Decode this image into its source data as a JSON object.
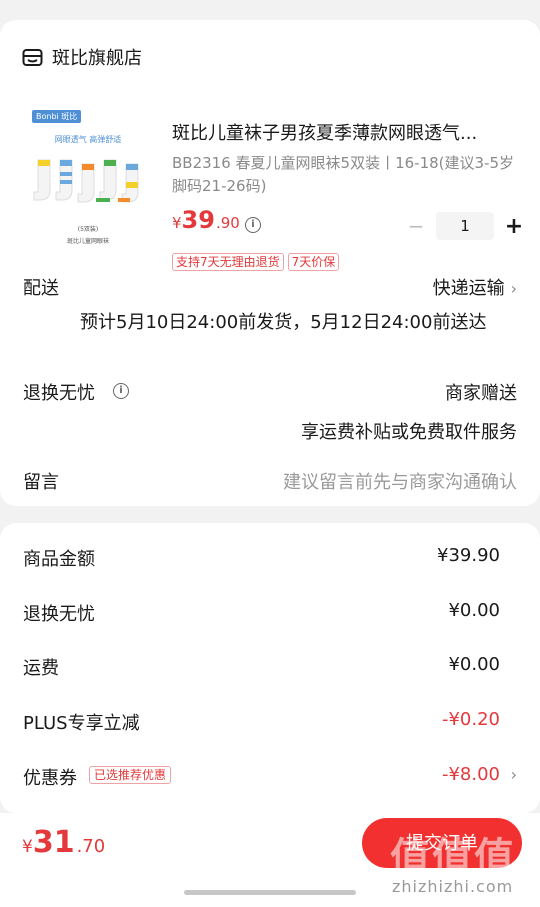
{
  "shop": {
    "name": "斑比旗舰店",
    "icon": "shop-icon"
  },
  "product": {
    "thumb": {
      "brand_tag": "Bonbi 斑比",
      "slogan": "网眼透气 高弹舒适",
      "count_label": "(5双装)",
      "caption": "斑比儿童网眼袜"
    },
    "title": "斑比儿童袜子男孩夏季薄款网眼透气...",
    "spec": "BB2316 春夏儿童网眼袜5双装丨16-18(建议3-5岁脚码21-26码)",
    "price": {
      "currency": "¥",
      "integer": "39",
      "decimal": ".90"
    },
    "quantity": "1",
    "tags": [
      "支持7天无理由退货",
      "7天价保"
    ]
  },
  "delivery": {
    "label": "配送",
    "method": "快递运输",
    "estimate": "预计5月10日24:00前发货，5月12日24:00前送达"
  },
  "return_service": {
    "label": "退换无忧",
    "value": "商家赠送",
    "desc": "享运费补贴或免费取件服务"
  },
  "note": {
    "label": "留言",
    "placeholder": "建议留言前先与商家沟通确认"
  },
  "summary": {
    "rows": [
      {
        "label": "商品金额",
        "value": "¥39.90"
      },
      {
        "label": "退换无忧",
        "value": "¥0.00"
      },
      {
        "label": "运费",
        "value": "¥0.00"
      },
      {
        "label": "PLUS专享立减",
        "value": "-¥0.20"
      },
      {
        "label": "优惠券",
        "value": "-¥8.00"
      }
    ],
    "coupon_tag": "已选推荐优惠"
  },
  "footer": {
    "total": {
      "currency": "¥",
      "integer": "31",
      "decimal": ".70"
    },
    "submit_label": "提交订单",
    "watermark": "值值值",
    "watermark_url": "zhizhizhi.com"
  },
  "colors": {
    "accent": "#e4393c",
    "button": "#f23030",
    "muted": "#8a8a8a"
  }
}
